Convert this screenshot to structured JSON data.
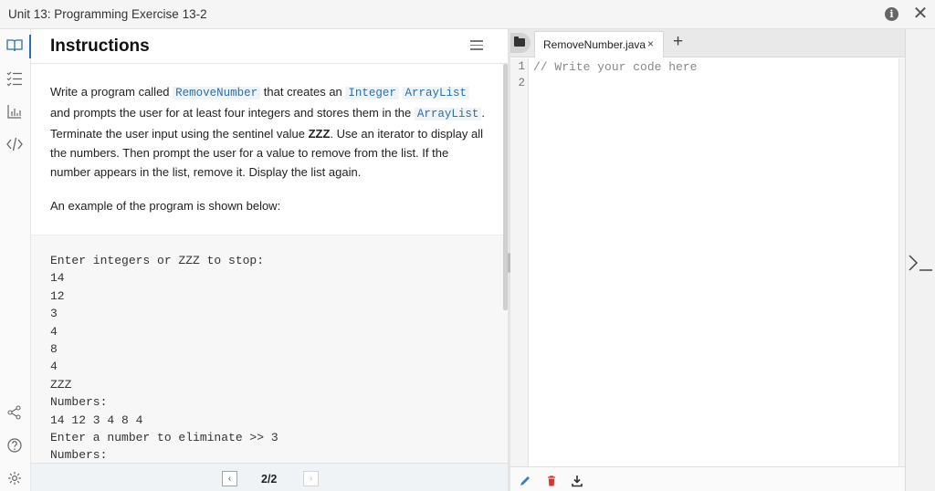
{
  "window": {
    "title": "Unit 13: Programming Exercise 13-2"
  },
  "panel": {
    "heading": "Instructions",
    "paragraph": [
      {
        "t": "Write a program called "
      },
      {
        "t": "RemoveNumber",
        "style": "code"
      },
      {
        "t": " that creates an "
      },
      {
        "t": "Integer",
        "style": "code"
      },
      {
        "t": " "
      },
      {
        "t": "ArrayList",
        "style": "code"
      },
      {
        "t": " and prompts the user for at least four integers and stores them in the "
      },
      {
        "t": "ArrayList",
        "style": "code"
      },
      {
        "t": ". Terminate the user input using the sentinel value "
      },
      {
        "t": "ZZZ",
        "style": "bold"
      },
      {
        "t": ". Use an iterator to display all the numbers. Then prompt the user for a value to remove from the list. If the number appears in the list, remove it. Display the list again."
      }
    ],
    "example_intro": "An example of the program is shown below:",
    "sample_output": [
      "Enter integers or ZZZ to stop:",
      "14",
      "12",
      "3",
      "4",
      "8",
      "4",
      "ZZZ",
      "Numbers:",
      "14 12 3 4 8 4",
      "Enter a number to eliminate >> 3",
      "Numbers:"
    ],
    "pager": {
      "prev": "‹",
      "page": "2/2",
      "next": "›"
    }
  },
  "editor": {
    "tab_name": "RemoveNumber.java",
    "tab_close": "×",
    "add_tab": "+",
    "line_numbers": [
      "1",
      "2"
    ],
    "code_lines": [
      "// Write your code here",
      ""
    ]
  },
  "colors": {
    "accent": "#2a6fb0",
    "inline_code": "#2b6ea8",
    "delete": "#d9342b"
  }
}
